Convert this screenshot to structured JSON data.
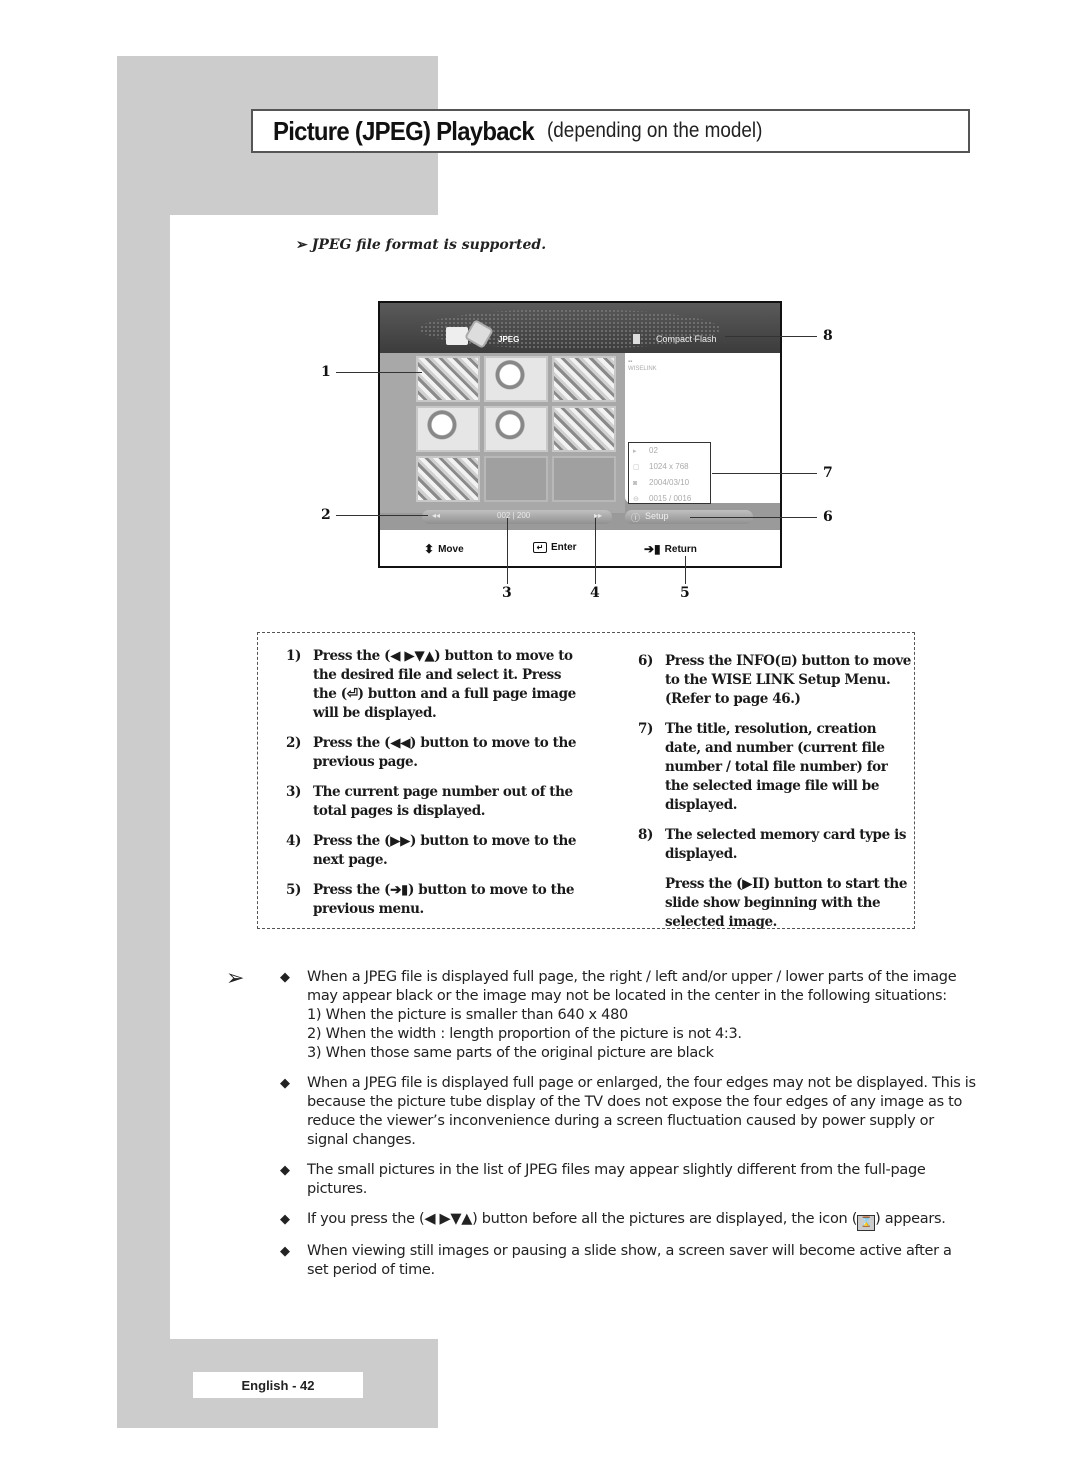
{
  "title": {
    "main": "Picture (JPEG) Playback",
    "sub": "(depending on the model)"
  },
  "intro_note": {
    "arrow": "➢",
    "text": "JPEG file format is supported."
  },
  "screen": {
    "format_label": "JPEG",
    "card_type": "Compact Flash",
    "brand": "WISELINK",
    "thumbnails": [
      {
        "state": "photo"
      },
      {
        "state": "photo"
      },
      {
        "state": "photo"
      },
      {
        "state": "photo"
      },
      {
        "state": "photo"
      },
      {
        "state": "photo"
      },
      {
        "state": "photo"
      },
      {
        "state": "empty"
      },
      {
        "state": "empty"
      }
    ],
    "info": {
      "title": "02",
      "resolution": "1024 x 768",
      "date": "2004/03/10",
      "number": "0015 / 0016"
    },
    "nav": {
      "prev_icon": "◂◂",
      "page": "002 | 200",
      "next_icon": "▸▸"
    },
    "setup_label": "Setup",
    "footer": {
      "move": "Move",
      "enter": "Enter",
      "return": "Return"
    }
  },
  "callouts": [
    "1",
    "2",
    "3",
    "4",
    "5",
    "6",
    "7",
    "8"
  ],
  "instructions_left": [
    {
      "num": "1)",
      "text": "Press the (◀ ▶▼▲) button to move to the desired file and select it. Press the (⏎) button and a full page image will be displayed."
    },
    {
      "num": "2)",
      "text": "Press the (◀◀) button to move to the previous page."
    },
    {
      "num": "3)",
      "text": "The current page number out of the total pages is displayed."
    },
    {
      "num": "4)",
      "text": "Press the (▶▶) button to move to the next page."
    },
    {
      "num": "5)",
      "text": "Press the (➔▮) button to move to the previous menu."
    }
  ],
  "instructions_right": [
    {
      "num": "6)",
      "text": "Press the INFO(⊡) button to move to the WISE LINK Setup Menu. (Refer to page 46.)"
    },
    {
      "num": "7)",
      "text": "The title, resolution, creation date, and number (current file number / total file number) for the selected image file will be displayed."
    },
    {
      "num": "8)",
      "text": "The selected memory card type is displayed."
    }
  ],
  "instructions_extra": "Press the (▶II) button to start the slide show beginning with the selected image.",
  "notes": {
    "arrow": "➢",
    "bullet": "◆",
    "items": [
      {
        "text": "When a JPEG file is displayed full page, the right / left and/or upper / lower parts of the image may appear black or the image may not be located in the center in the following situations:",
        "sub": [
          "1) When the picture is smaller than 640 x 480",
          "2) When the width : length proportion of the picture is not 4:3.",
          "3) When those same parts of the original picture are black"
        ]
      },
      {
        "text": "When a JPEG file is displayed full page or enlarged, the four edges may not be displayed. This is because the picture tube display of the TV does not expose the four edges of any image as to reduce the viewer’s inconvenience during a screen fluctuation caused by power supply or signal changes."
      },
      {
        "text": "The small pictures in the list of JPEG files may appear slightly different from the full-page pictures."
      },
      {
        "text_before": "If you press the (◀ ▶▼▲) button before all the pictures are displayed, the icon (",
        "icon": "⌛",
        "text_after": ") appears."
      },
      {
        "text": "When viewing still images or pausing a slide show, a screen saver will become active after a set period of time."
      }
    ]
  },
  "footer": {
    "page_label": "English - 42"
  }
}
